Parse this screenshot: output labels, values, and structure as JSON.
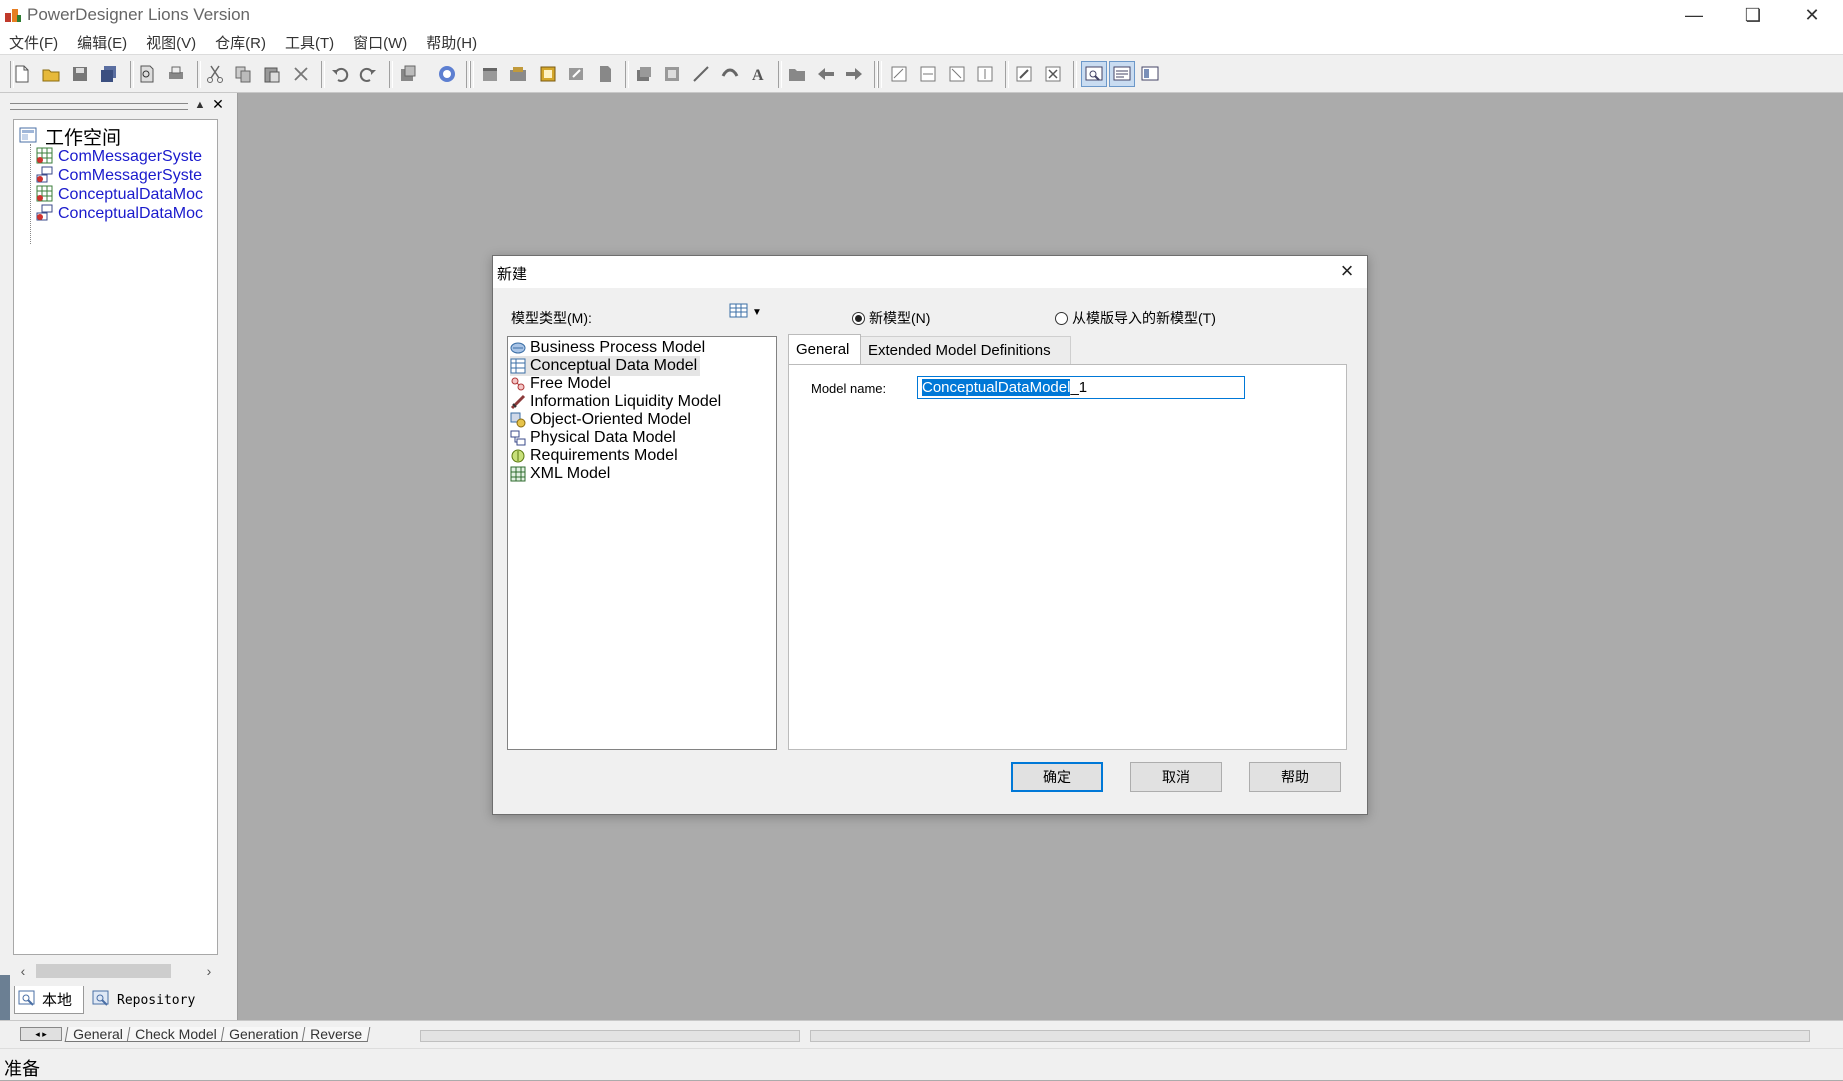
{
  "app": {
    "title": "PowerDesigner Lions Version"
  },
  "window_controls": {
    "minimize": "—",
    "maximize": "❏",
    "close": "✕"
  },
  "menu": [
    "文件(F)",
    "编辑(E)",
    "视图(V)",
    "仓库(R)",
    "工具(T)",
    "窗口(W)",
    "帮助(H)"
  ],
  "workspace": {
    "root_label": "工作空间",
    "items": [
      {
        "label": "ComMessagerSyste",
        "icon": "conceptual-model-icon"
      },
      {
        "label": "ComMessagerSyste",
        "icon": "physical-model-icon"
      },
      {
        "label": "ConceptualDataMoc",
        "icon": "conceptual-model-icon"
      },
      {
        "label": "ConceptualDataMoc",
        "icon": "physical-model-icon"
      }
    ],
    "tabs": {
      "local": "本地",
      "repository": "Repository"
    }
  },
  "bottom_tabs": [
    "General",
    "Check Model",
    "Generation",
    "Reverse"
  ],
  "status": {
    "text": "准备"
  },
  "dialog": {
    "title": "新建",
    "model_type_label": "模型类型(M):",
    "radio_new_model": "新模型(N)",
    "radio_from_template": "从模版导入的新模型(T)",
    "model_types": [
      {
        "label": "Business Process Model",
        "icon": "business-process-icon"
      },
      {
        "label": "Conceptual Data Model",
        "icon": "conceptual-data-icon",
        "selected": true
      },
      {
        "label": "Free Model",
        "icon": "free-model-icon"
      },
      {
        "label": "Information Liquidity Model",
        "icon": "information-liquidity-icon"
      },
      {
        "label": "Object-Oriented Model",
        "icon": "object-oriented-icon"
      },
      {
        "label": "Physical Data Model",
        "icon": "physical-data-icon"
      },
      {
        "label": "Requirements Model",
        "icon": "requirements-icon"
      },
      {
        "label": "XML Model",
        "icon": "xml-model-icon"
      }
    ],
    "tabs": {
      "general": "General",
      "extended": "Extended Model Definitions"
    },
    "model_name_label": "Model name:",
    "model_name_selected": "ConceptualDataModel",
    "model_name_rest": "_1",
    "buttons": {
      "ok": "确定",
      "cancel": "取消",
      "help": "帮助"
    }
  },
  "colors": {
    "selection": "#0078d7",
    "workspace_link": "#1a1acc",
    "background": "#ababab"
  }
}
